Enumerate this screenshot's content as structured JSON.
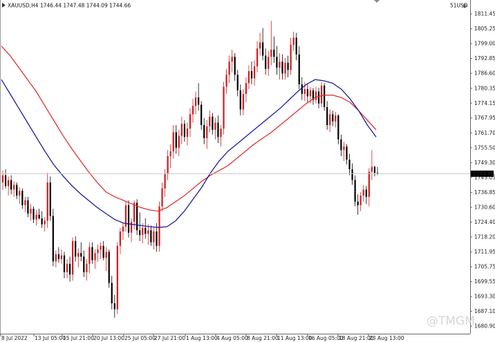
{
  "header": {
    "symbol_info": "XAUUSD,H4  1746.44 1747.48 1744.09 1744.66",
    "indicator_label": "51USD",
    "close_symbol": "⊗"
  },
  "watermark": {
    "text": "@TMGM"
  },
  "colors": {
    "bull": "#d7191c",
    "bear": "#000000",
    "ma_fast": "#1c1c9e",
    "ma_slow": "#e0322e",
    "price_line": "#c8c8c8",
    "price_tag_bg": "#000000",
    "price_tag_text": "#ffffff"
  },
  "chart_data": {
    "type": "candlestick",
    "ylim": [
      1679.8,
      1813.5
    ],
    "y_ticks": [
      "1811.45",
      "1805.25",
      "1799.00",
      "1792.85",
      "1786.60",
      "1780.35",
      "1774.15",
      "1767.95",
      "1761.70",
      "1755.50",
      "1749.30",
      "1743.05",
      "1736.85",
      "1730.60",
      "1724.40",
      "1718.20",
      "1711.95",
      "1705.75",
      "1699.55",
      "1693.30",
      "1687.10",
      "1680.90"
    ],
    "x_ticks": [
      "8 Jul 2022",
      "13 Jul 05:00",
      "15 Jul 21:00",
      "20 Jul 13:00",
      "25 Jul 05:00",
      "27 Jul 21:00",
      "1 Aug 13:00",
      "4 Aug 05:00",
      "8 Aug 21:00",
      "11 Aug 13:00",
      "16 Aug 05:00",
      "18 Aug 21:00",
      "23 Aug 13:00"
    ],
    "current_price": "1744.66",
    "series_ma_fast": [
      1784.0,
      1778.0,
      1772.0,
      1766.0,
      1760.0,
      1754.0,
      1748.5,
      1744.0,
      1740.0,
      1736.5,
      1733.5,
      1730.5,
      1728.0,
      1725.5,
      1724.0,
      1723.5,
      1723.0,
      1722.5,
      1722.2,
      1722.5,
      1725.0,
      1729.0,
      1734.0,
      1739.0,
      1745.0,
      1750.0,
      1754.0,
      1757.0,
      1760.0,
      1763.0,
      1766.0,
      1769.0,
      1772.0,
      1775.5,
      1779.0,
      1782.0,
      1784.0,
      1783.5,
      1782.5,
      1780.0,
      1776.0,
      1771.0,
      1765.0,
      1760.0
    ],
    "series_ma_slow": [
      1798.0,
      1794.0,
      1789.0,
      1784.0,
      1779.0,
      1773.0,
      1767.0,
      1761.0,
      1755.5,
      1750.5,
      1745.5,
      1741.0,
      1737.0,
      1735.0,
      1733.5,
      1732.0,
      1730.5,
      1729.5,
      1729.0,
      1730.5,
      1733.0,
      1735.5,
      1738.5,
      1741.5,
      1744.0,
      1746.0,
      1748.0,
      1751.0,
      1754.0,
      1757.0,
      1759.5,
      1762.0,
      1765.0,
      1768.0,
      1771.0,
      1774.0,
      1776.5,
      1777.5,
      1777.5,
      1776.5,
      1774.5,
      1771.0,
      1767.0,
      1763.0
    ],
    "candles": [
      {
        "o": 1741.0,
        "h": 1746.0,
        "l": 1738.0,
        "c": 1744.0
      },
      {
        "o": 1744.0,
        "h": 1746.5,
        "l": 1738.5,
        "c": 1739.5
      },
      {
        "o": 1739.5,
        "h": 1743.5,
        "l": 1735.5,
        "c": 1742.0
      },
      {
        "o": 1742.0,
        "h": 1744.0,
        "l": 1736.0,
        "c": 1738.0
      },
      {
        "o": 1738.0,
        "h": 1741.5,
        "l": 1735.0,
        "c": 1740.0
      },
      {
        "o": 1740.0,
        "h": 1741.0,
        "l": 1734.0,
        "c": 1735.5
      },
      {
        "o": 1735.5,
        "h": 1739.0,
        "l": 1732.0,
        "c": 1737.5
      },
      {
        "o": 1737.5,
        "h": 1738.5,
        "l": 1730.0,
        "c": 1731.5
      },
      {
        "o": 1731.5,
        "h": 1735.0,
        "l": 1728.5,
        "c": 1733.5
      },
      {
        "o": 1733.5,
        "h": 1735.0,
        "l": 1726.5,
        "c": 1728.0
      },
      {
        "o": 1728.0,
        "h": 1732.0,
        "l": 1725.0,
        "c": 1730.0
      },
      {
        "o": 1730.0,
        "h": 1731.0,
        "l": 1724.0,
        "c": 1725.5
      },
      {
        "o": 1725.5,
        "h": 1729.5,
        "l": 1723.0,
        "c": 1727.5
      },
      {
        "o": 1727.5,
        "h": 1730.0,
        "l": 1725.5,
        "c": 1726.0
      },
      {
        "o": 1726.0,
        "h": 1729.0,
        "l": 1722.0,
        "c": 1723.5
      },
      {
        "o": 1723.5,
        "h": 1726.5,
        "l": 1720.5,
        "c": 1725.0
      },
      {
        "o": 1725.0,
        "h": 1745.0,
        "l": 1722.0,
        "c": 1741.0
      },
      {
        "o": 1741.0,
        "h": 1743.5,
        "l": 1725.0,
        "c": 1727.0
      },
      {
        "o": 1727.0,
        "h": 1730.0,
        "l": 1706.0,
        "c": 1708.0
      },
      {
        "o": 1708.0,
        "h": 1712.5,
        "l": 1705.5,
        "c": 1711.0
      },
      {
        "o": 1711.0,
        "h": 1714.0,
        "l": 1707.5,
        "c": 1709.0
      },
      {
        "o": 1709.0,
        "h": 1713.0,
        "l": 1707.0,
        "c": 1710.5
      },
      {
        "o": 1710.5,
        "h": 1712.0,
        "l": 1701.0,
        "c": 1703.5
      },
      {
        "o": 1703.5,
        "h": 1709.0,
        "l": 1701.0,
        "c": 1707.0
      },
      {
        "o": 1707.0,
        "h": 1710.0,
        "l": 1699.5,
        "c": 1702.5
      },
      {
        "o": 1702.5,
        "h": 1718.0,
        "l": 1700.0,
        "c": 1716.5
      },
      {
        "o": 1716.5,
        "h": 1718.5,
        "l": 1708.0,
        "c": 1710.0
      },
      {
        "o": 1710.0,
        "h": 1713.5,
        "l": 1705.5,
        "c": 1711.5
      },
      {
        "o": 1711.5,
        "h": 1716.0,
        "l": 1708.0,
        "c": 1710.0
      },
      {
        "o": 1710.0,
        "h": 1712.5,
        "l": 1701.5,
        "c": 1703.5
      },
      {
        "o": 1703.5,
        "h": 1709.0,
        "l": 1700.0,
        "c": 1707.0
      },
      {
        "o": 1707.0,
        "h": 1716.0,
        "l": 1703.0,
        "c": 1714.0
      },
      {
        "o": 1714.0,
        "h": 1716.0,
        "l": 1707.0,
        "c": 1708.5
      },
      {
        "o": 1708.5,
        "h": 1713.0,
        "l": 1705.0,
        "c": 1711.5
      },
      {
        "o": 1711.5,
        "h": 1715.0,
        "l": 1708.0,
        "c": 1713.0
      },
      {
        "o": 1713.0,
        "h": 1716.0,
        "l": 1709.0,
        "c": 1714.5
      },
      {
        "o": 1714.5,
        "h": 1716.5,
        "l": 1708.5,
        "c": 1709.5
      },
      {
        "o": 1709.5,
        "h": 1714.0,
        "l": 1704.0,
        "c": 1712.0
      },
      {
        "o": 1712.0,
        "h": 1713.0,
        "l": 1697.0,
        "c": 1699.0
      },
      {
        "o": 1699.0,
        "h": 1702.0,
        "l": 1688.0,
        "c": 1690.5
      },
      {
        "o": 1690.5,
        "h": 1694.0,
        "l": 1684.5,
        "c": 1688.0
      },
      {
        "o": 1688.0,
        "h": 1716.0,
        "l": 1686.0,
        "c": 1714.5
      },
      {
        "o": 1714.5,
        "h": 1722.0,
        "l": 1711.0,
        "c": 1720.5
      },
      {
        "o": 1720.5,
        "h": 1724.0,
        "l": 1717.0,
        "c": 1722.5
      },
      {
        "o": 1722.5,
        "h": 1733.0,
        "l": 1720.5,
        "c": 1731.5
      },
      {
        "o": 1731.5,
        "h": 1733.5,
        "l": 1718.0,
        "c": 1720.0
      },
      {
        "o": 1720.0,
        "h": 1726.0,
        "l": 1716.0,
        "c": 1724.5
      },
      {
        "o": 1724.5,
        "h": 1733.5,
        "l": 1721.5,
        "c": 1732.5
      },
      {
        "o": 1732.5,
        "h": 1734.0,
        "l": 1719.0,
        "c": 1721.0
      },
      {
        "o": 1721.0,
        "h": 1728.5,
        "l": 1716.5,
        "c": 1719.0
      },
      {
        "o": 1719.0,
        "h": 1724.0,
        "l": 1715.5,
        "c": 1722.0
      },
      {
        "o": 1722.0,
        "h": 1726.0,
        "l": 1717.5,
        "c": 1719.5
      },
      {
        "o": 1719.5,
        "h": 1723.5,
        "l": 1715.0,
        "c": 1721.0
      },
      {
        "o": 1721.0,
        "h": 1723.0,
        "l": 1714.5,
        "c": 1716.0
      },
      {
        "o": 1716.0,
        "h": 1722.0,
        "l": 1713.0,
        "c": 1720.5
      },
      {
        "o": 1720.5,
        "h": 1724.0,
        "l": 1712.0,
        "c": 1714.5
      },
      {
        "o": 1714.5,
        "h": 1733.0,
        "l": 1712.0,
        "c": 1731.0
      },
      {
        "o": 1731.0,
        "h": 1741.0,
        "l": 1729.0,
        "c": 1738.5
      },
      {
        "o": 1738.5,
        "h": 1746.5,
        "l": 1735.0,
        "c": 1744.5
      },
      {
        "o": 1744.5,
        "h": 1754.5,
        "l": 1742.0,
        "c": 1752.0
      },
      {
        "o": 1752.0,
        "h": 1757.0,
        "l": 1747.0,
        "c": 1754.0
      },
      {
        "o": 1754.0,
        "h": 1765.0,
        "l": 1751.0,
        "c": 1762.0
      },
      {
        "o": 1762.0,
        "h": 1765.0,
        "l": 1753.0,
        "c": 1755.5
      },
      {
        "o": 1755.5,
        "h": 1763.0,
        "l": 1752.0,
        "c": 1760.5
      },
      {
        "o": 1760.5,
        "h": 1768.5,
        "l": 1757.0,
        "c": 1765.5
      },
      {
        "o": 1765.5,
        "h": 1767.0,
        "l": 1758.0,
        "c": 1760.0
      },
      {
        "o": 1760.0,
        "h": 1766.0,
        "l": 1756.5,
        "c": 1763.5
      },
      {
        "o": 1763.5,
        "h": 1772.0,
        "l": 1760.0,
        "c": 1769.5
      },
      {
        "o": 1769.5,
        "h": 1776.0,
        "l": 1766.0,
        "c": 1773.0
      },
      {
        "o": 1773.0,
        "h": 1779.0,
        "l": 1769.5,
        "c": 1776.5
      },
      {
        "o": 1776.5,
        "h": 1782.5,
        "l": 1771.0,
        "c": 1773.5
      },
      {
        "o": 1773.5,
        "h": 1775.0,
        "l": 1763.0,
        "c": 1765.0
      },
      {
        "o": 1765.0,
        "h": 1768.0,
        "l": 1757.0,
        "c": 1759.5
      },
      {
        "o": 1759.5,
        "h": 1767.0,
        "l": 1755.0,
        "c": 1764.5
      },
      {
        "o": 1764.5,
        "h": 1771.0,
        "l": 1762.0,
        "c": 1768.5
      },
      {
        "o": 1768.5,
        "h": 1770.0,
        "l": 1761.0,
        "c": 1763.0
      },
      {
        "o": 1763.0,
        "h": 1768.0,
        "l": 1759.0,
        "c": 1766.0
      },
      {
        "o": 1766.0,
        "h": 1769.0,
        "l": 1757.5,
        "c": 1760.0
      },
      {
        "o": 1760.0,
        "h": 1765.0,
        "l": 1756.0,
        "c": 1763.5
      },
      {
        "o": 1763.5,
        "h": 1783.0,
        "l": 1761.0,
        "c": 1781.0
      },
      {
        "o": 1781.0,
        "h": 1788.5,
        "l": 1778.0,
        "c": 1786.0
      },
      {
        "o": 1786.0,
        "h": 1794.0,
        "l": 1782.5,
        "c": 1791.5
      },
      {
        "o": 1791.5,
        "h": 1796.5,
        "l": 1787.0,
        "c": 1793.5
      },
      {
        "o": 1793.5,
        "h": 1795.0,
        "l": 1783.5,
        "c": 1786.0
      },
      {
        "o": 1786.0,
        "h": 1788.0,
        "l": 1777.0,
        "c": 1779.5
      },
      {
        "o": 1779.5,
        "h": 1782.0,
        "l": 1769.0,
        "c": 1771.5
      },
      {
        "o": 1771.5,
        "h": 1780.0,
        "l": 1769.0,
        "c": 1778.0
      },
      {
        "o": 1778.0,
        "h": 1785.0,
        "l": 1774.5,
        "c": 1782.5
      },
      {
        "o": 1782.5,
        "h": 1790.0,
        "l": 1780.0,
        "c": 1787.5
      },
      {
        "o": 1787.5,
        "h": 1791.5,
        "l": 1782.0,
        "c": 1784.5
      },
      {
        "o": 1784.5,
        "h": 1792.0,
        "l": 1781.5,
        "c": 1789.5
      },
      {
        "o": 1789.5,
        "h": 1800.0,
        "l": 1787.0,
        "c": 1797.0
      },
      {
        "o": 1797.0,
        "h": 1803.5,
        "l": 1794.0,
        "c": 1799.5
      },
      {
        "o": 1799.5,
        "h": 1805.5,
        "l": 1792.0,
        "c": 1794.0
      },
      {
        "o": 1794.0,
        "h": 1797.0,
        "l": 1786.0,
        "c": 1788.5
      },
      {
        "o": 1788.5,
        "h": 1796.0,
        "l": 1785.5,
        "c": 1793.5
      },
      {
        "o": 1793.5,
        "h": 1808.5,
        "l": 1790.0,
        "c": 1796.5
      },
      {
        "o": 1796.5,
        "h": 1802.0,
        "l": 1791.0,
        "c": 1793.5
      },
      {
        "o": 1793.5,
        "h": 1798.0,
        "l": 1786.0,
        "c": 1789.0
      },
      {
        "o": 1789.0,
        "h": 1795.0,
        "l": 1784.0,
        "c": 1791.5
      },
      {
        "o": 1791.5,
        "h": 1794.5,
        "l": 1784.0,
        "c": 1786.5
      },
      {
        "o": 1786.5,
        "h": 1793.0,
        "l": 1784.0,
        "c": 1791.0
      },
      {
        "o": 1791.0,
        "h": 1794.0,
        "l": 1785.0,
        "c": 1788.0
      },
      {
        "o": 1788.0,
        "h": 1801.5,
        "l": 1786.0,
        "c": 1798.5
      },
      {
        "o": 1798.5,
        "h": 1804.0,
        "l": 1796.0,
        "c": 1801.5
      },
      {
        "o": 1801.5,
        "h": 1803.5,
        "l": 1792.0,
        "c": 1794.5
      },
      {
        "o": 1794.5,
        "h": 1798.0,
        "l": 1780.0,
        "c": 1782.0
      },
      {
        "o": 1782.0,
        "h": 1785.0,
        "l": 1775.5,
        "c": 1778.0
      },
      {
        "o": 1778.0,
        "h": 1783.0,
        "l": 1775.0,
        "c": 1780.0
      },
      {
        "o": 1780.0,
        "h": 1782.0,
        "l": 1774.5,
        "c": 1777.0
      },
      {
        "o": 1777.0,
        "h": 1781.0,
        "l": 1774.0,
        "c": 1779.5
      },
      {
        "o": 1779.5,
        "h": 1780.5,
        "l": 1773.5,
        "c": 1775.5
      },
      {
        "o": 1775.5,
        "h": 1781.0,
        "l": 1774.0,
        "c": 1779.0
      },
      {
        "o": 1779.0,
        "h": 1780.5,
        "l": 1772.0,
        "c": 1774.0
      },
      {
        "o": 1774.0,
        "h": 1783.0,
        "l": 1772.5,
        "c": 1781.5
      },
      {
        "o": 1781.5,
        "h": 1782.5,
        "l": 1771.0,
        "c": 1772.5
      },
      {
        "o": 1772.5,
        "h": 1775.0,
        "l": 1763.0,
        "c": 1765.0
      },
      {
        "o": 1765.0,
        "h": 1771.5,
        "l": 1762.0,
        "c": 1769.5
      },
      {
        "o": 1769.5,
        "h": 1771.0,
        "l": 1764.5,
        "c": 1766.5
      },
      {
        "o": 1766.5,
        "h": 1770.5,
        "l": 1764.0,
        "c": 1769.0
      },
      {
        "o": 1769.0,
        "h": 1769.5,
        "l": 1757.0,
        "c": 1759.0
      },
      {
        "o": 1759.0,
        "h": 1761.0,
        "l": 1752.0,
        "c": 1754.5
      },
      {
        "o": 1754.5,
        "h": 1758.0,
        "l": 1750.0,
        "c": 1756.0
      },
      {
        "o": 1756.0,
        "h": 1757.0,
        "l": 1748.5,
        "c": 1750.5
      },
      {
        "o": 1750.5,
        "h": 1753.0,
        "l": 1744.0,
        "c": 1746.5
      },
      {
        "o": 1746.5,
        "h": 1749.0,
        "l": 1740.0,
        "c": 1742.0
      },
      {
        "o": 1742.0,
        "h": 1744.0,
        "l": 1731.0,
        "c": 1733.0
      },
      {
        "o": 1733.0,
        "h": 1736.0,
        "l": 1727.5,
        "c": 1731.5
      },
      {
        "o": 1731.5,
        "h": 1737.0,
        "l": 1729.0,
        "c": 1735.5
      },
      {
        "o": 1735.5,
        "h": 1740.0,
        "l": 1733.0,
        "c": 1738.0
      },
      {
        "o": 1738.0,
        "h": 1739.5,
        "l": 1732.0,
        "c": 1735.0
      },
      {
        "o": 1735.0,
        "h": 1747.0,
        "l": 1731.0,
        "c": 1745.5
      },
      {
        "o": 1745.5,
        "h": 1754.5,
        "l": 1742.0,
        "c": 1747.5
      },
      {
        "o": 1747.5,
        "h": 1748.0,
        "l": 1743.5,
        "c": 1745.0
      },
      {
        "o": 1745.0,
        "h": 1747.5,
        "l": 1744.1,
        "c": 1744.66
      }
    ]
  }
}
